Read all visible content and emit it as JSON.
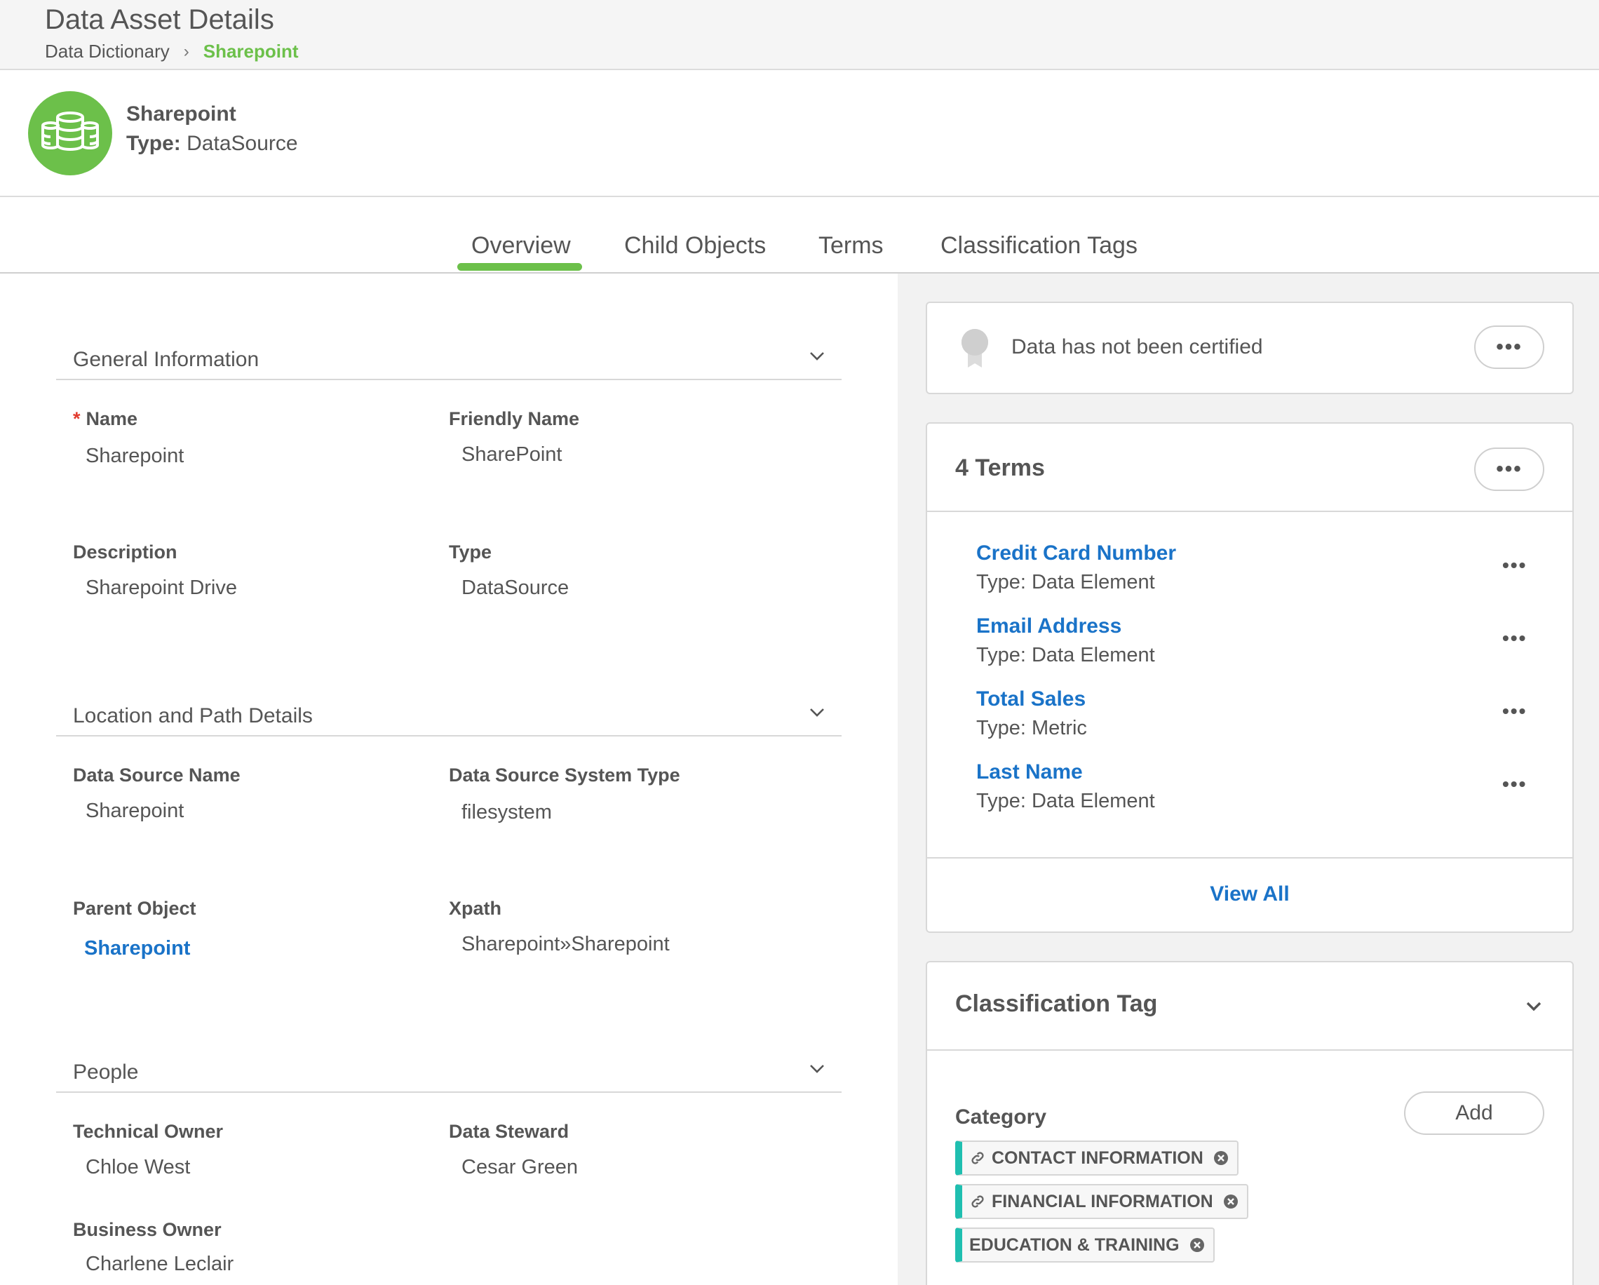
{
  "header": {
    "title": "Data Asset Details",
    "breadcrumb": {
      "home": "Data Dictionary",
      "separator": "›",
      "current": "Sharepoint"
    }
  },
  "asset": {
    "name": "Sharepoint",
    "type_label": "Type:",
    "type_value": "DataSource",
    "icon": "database-icon"
  },
  "tabs": [
    {
      "label": "Overview",
      "active": true
    },
    {
      "label": "Child Objects",
      "active": false
    },
    {
      "label": "Terms",
      "active": false
    },
    {
      "label": "Classification Tags",
      "active": false
    }
  ],
  "sections": {
    "general": {
      "title": "General Information",
      "name_label": "Name",
      "name_required": "*",
      "name_value": "Sharepoint",
      "friendly_label": "Friendly Name",
      "friendly_value": "SharePoint",
      "description_label": "Description",
      "description_value": "Sharepoint Drive",
      "type_label": "Type",
      "type_value": "DataSource"
    },
    "location": {
      "title": "Location and Path Details",
      "ds_name_label": "Data Source Name",
      "ds_name_value": "Sharepoint",
      "ds_system_label": "Data Source System Type",
      "ds_system_value": "filesystem",
      "parent_label": "Parent Object",
      "parent_value": "Sharepoint",
      "xpath_label": "Xpath",
      "xpath_value": "Sharepoint»Sharepoint"
    },
    "people": {
      "title": "People",
      "tech_owner_label": "Technical Owner",
      "tech_owner_value": "Chloe West",
      "steward_label": "Data Steward",
      "steward_value": "Cesar Green",
      "business_owner_label": "Business Owner",
      "business_owner_value": "Charlene Leclair"
    }
  },
  "certification": {
    "text": "Data has not been certified",
    "more": "•••"
  },
  "terms": {
    "title": "4 Terms",
    "more": "•••",
    "items": [
      {
        "name": "Credit Card Number",
        "type": "Type: Data Element"
      },
      {
        "name": "Email Address",
        "type": "Type: Data Element"
      },
      {
        "name": "Total Sales",
        "type": "Type: Metric"
      },
      {
        "name": "Last Name",
        "type": "Type: Data Element"
      }
    ],
    "item_more": "•••",
    "view_all": "View All"
  },
  "classification": {
    "title": "Classification Tag",
    "category_label": "Category",
    "add_label": "Add",
    "tags": [
      {
        "label": "CONTACT INFORMATION",
        "linked": true
      },
      {
        "label": "FINANCIAL INFORMATION",
        "linked": true
      },
      {
        "label": "EDUCATION & TRAINING",
        "linked": false
      }
    ],
    "tag_accent": "#1fbfb0"
  },
  "colors": {
    "brand_green": "#6cc04a",
    "link_blue": "#1a73c8",
    "required_red": "#e23b2e"
  }
}
